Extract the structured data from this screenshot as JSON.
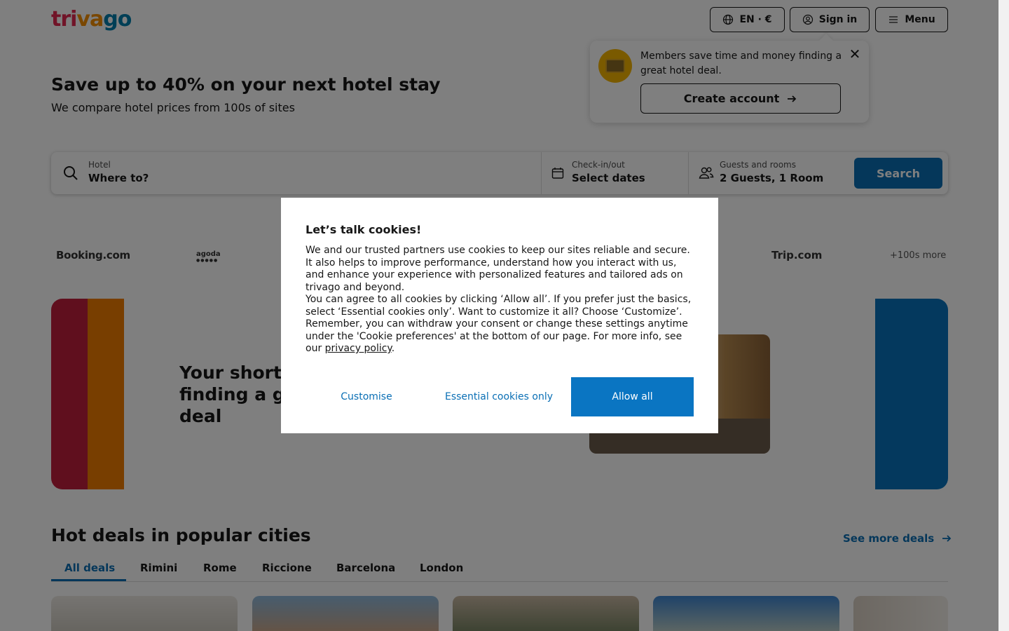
{
  "header": {
    "logo": {
      "part1": "tri",
      "part2": "va",
      "part3": "go"
    },
    "lang_label": "EN · €",
    "signin_label": "Sign in",
    "menu_label": "Menu"
  },
  "popover": {
    "text": "Members save time and money finding a great hotel deal.",
    "cta_label": "Create account"
  },
  "hero": {
    "title": "Save up to 40% on your next hotel stay",
    "subtitle": "We compare hotel prices from 100s of sites"
  },
  "search": {
    "hotel_label": "Hotel",
    "hotel_value": "Where to?",
    "dates_label": "Check-in/out",
    "dates_value": "Select dates",
    "guests_label": "Guests and rooms",
    "guests_value": "2 Guests, 1 Room",
    "button_label": "Search"
  },
  "partners": {
    "booking": "Booking.com",
    "agoda": "agoda",
    "agoda_dots": "●●●●●",
    "trip": "Trip.com",
    "more": "+100s more"
  },
  "banner": {
    "title_line1": "Your shorte",
    "title_line2": "finding a g",
    "title_line3": "deal"
  },
  "deals": {
    "title": "Hot deals in popular cities",
    "see_more": "See more deals",
    "tabs": [
      "All deals",
      "Rimini",
      "Rome",
      "Riccione",
      "Barcelona",
      "London"
    ]
  },
  "cookie": {
    "title": "Let’s talk cookies!",
    "paragraph1": "We and our trusted partners use cookies to keep our sites reliable and secure. It also helps to improve performance, understand how you interact with us, and enhance your experience with personalized features and tailored ads on trivago and beyond.",
    "paragraph2": "You can agree to all cookies by clicking ‘Allow all’. If you prefer just the basics, select ‘Essential cookies only’. Want to customize it all? Choose ‘Customize’. Remember, you can withdraw your consent or change these settings anytime under the 'Cookie preferences' at the bottom of our page. For more info, see our",
    "privacy_link": "privacy policy",
    "period": ".",
    "customise_label": "Customise",
    "essential_label": "Essential cookies only",
    "allow_label": "Allow all"
  },
  "colors": {
    "brand_blue": "#0a6fb5",
    "brand_red": "#e32851",
    "brand_orange": "#f48f00",
    "allow_button": "#0a75c2"
  }
}
